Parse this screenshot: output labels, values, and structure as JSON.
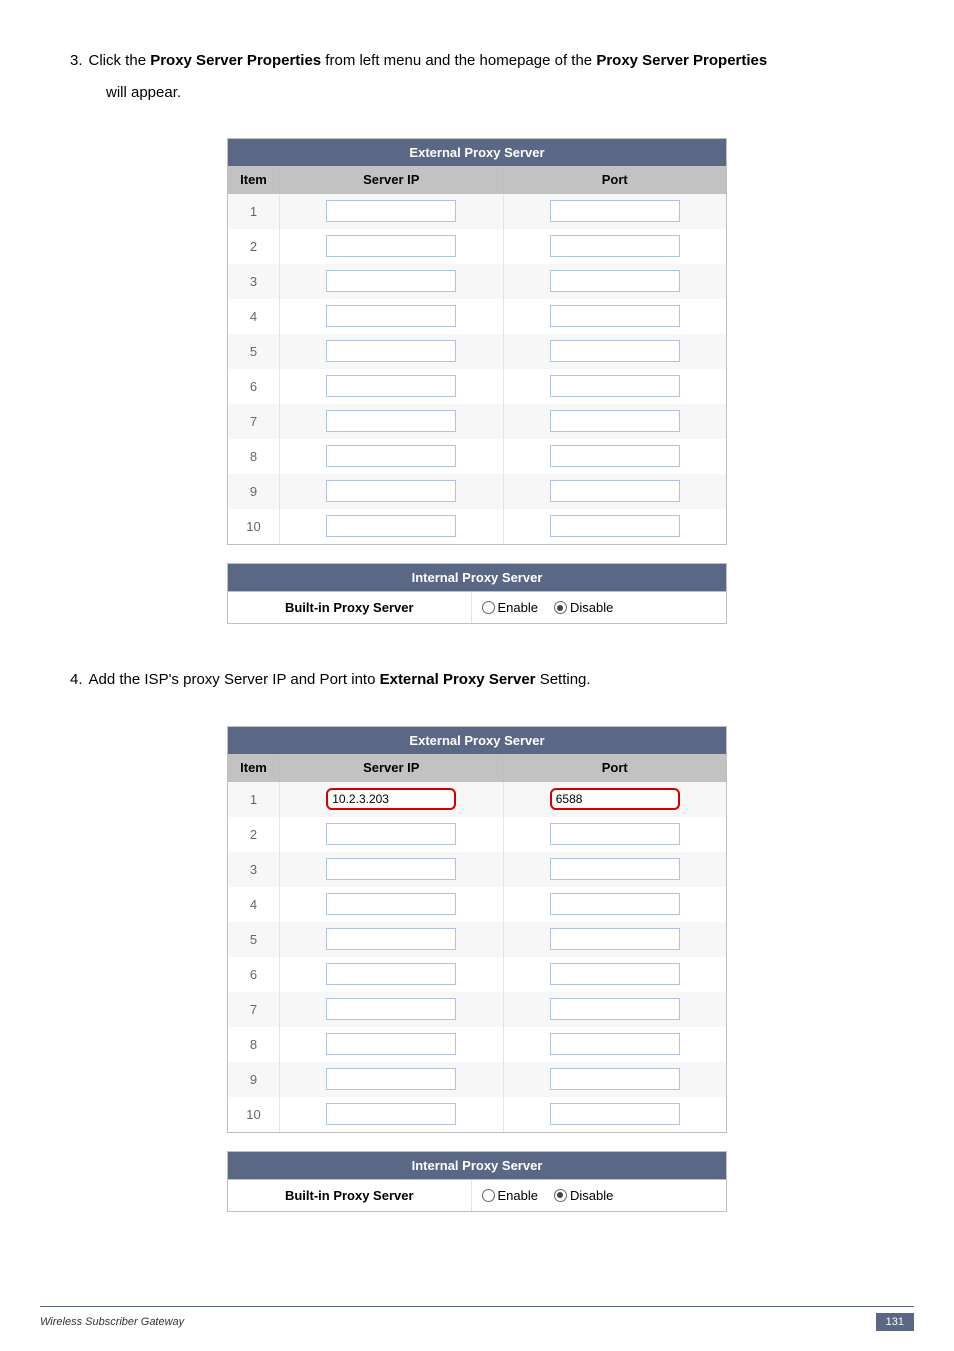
{
  "steps": {
    "3": {
      "num": "3.",
      "t1": "Click the ",
      "b1": "Proxy Server Properties",
      "t2": " from left menu and the homepage of the ",
      "b2": "Proxy Server Properties",
      "t3": " will appear."
    },
    "4": {
      "num": "4.",
      "t1": "Add the ISP's proxy Server IP and Port into ",
      "b1": "External Proxy Server",
      "t2": " Setting."
    }
  },
  "proxy": {
    "ext_title": "External Proxy Server",
    "col_item": "Item",
    "col_server": "Server IP",
    "col_port": "Port",
    "items": [
      "1",
      "2",
      "3",
      "4",
      "5",
      "6",
      "7",
      "8",
      "9",
      "10"
    ],
    "values_a": {
      "server": [
        "",
        "",
        "",
        "",
        "",
        "",
        "",
        "",
        "",
        ""
      ],
      "port": [
        "",
        "",
        "",
        "",
        "",
        "",
        "",
        "",
        "",
        ""
      ]
    },
    "values_b": {
      "server": [
        "10.2.3.203",
        "",
        "",
        "",
        "",
        "",
        "",
        "",
        "",
        ""
      ],
      "port": [
        "6588",
        "",
        "",
        "",
        "",
        "",
        "",
        "",
        "",
        ""
      ]
    },
    "int_title": "Internal Proxy Server",
    "builtin_label": "Built-in Proxy Server",
    "enable": "Enable",
    "disable": "Disable",
    "builtin_value": "disable"
  },
  "footer": {
    "title": "Wireless Subscriber Gateway",
    "page": "131"
  }
}
